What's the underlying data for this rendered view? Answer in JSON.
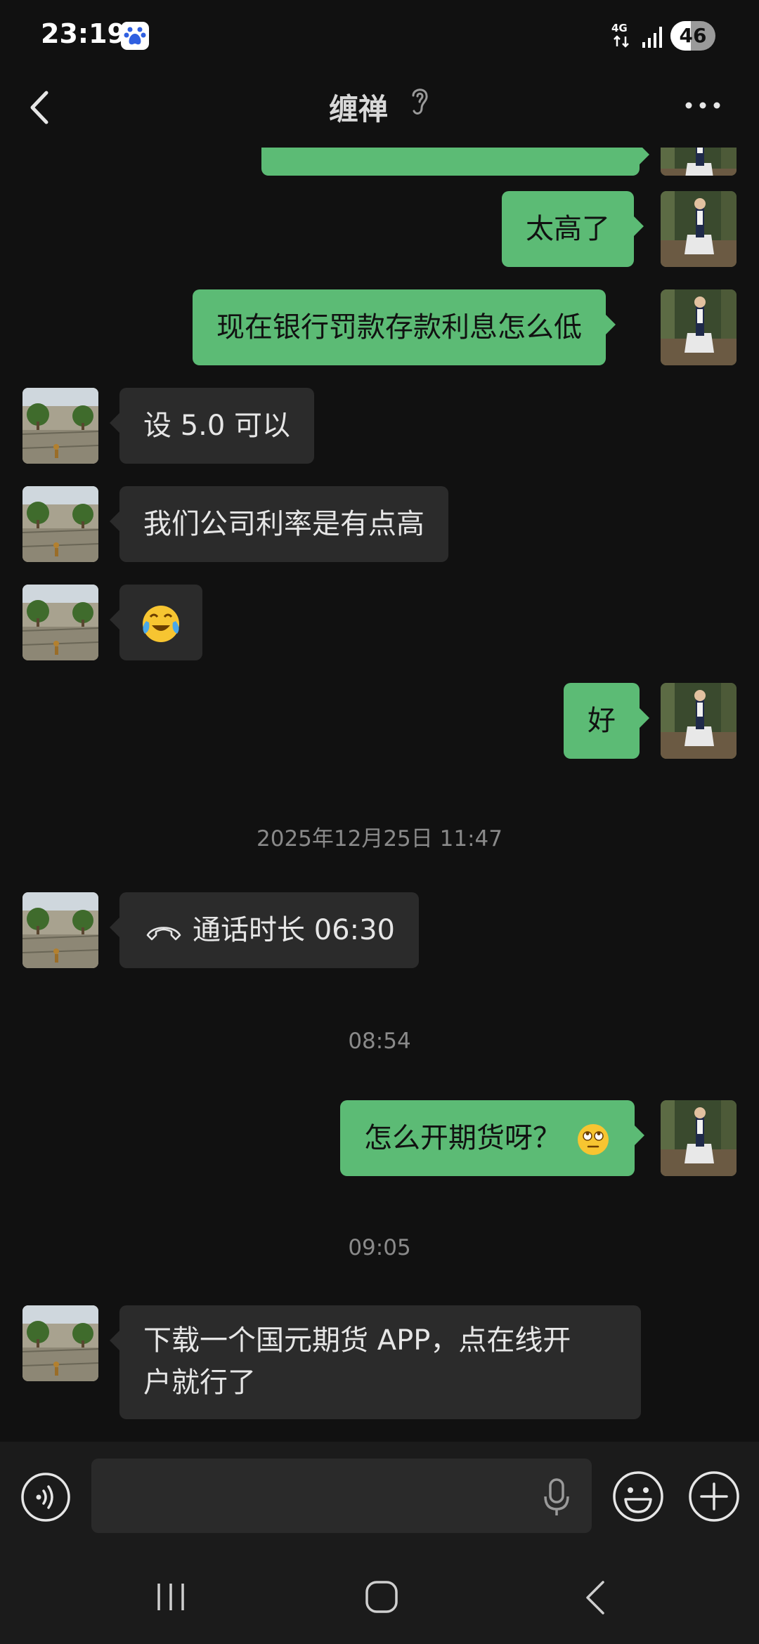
{
  "status_bar": {
    "time": "23:19",
    "network": "4G",
    "battery": "46",
    "battery_level": 0.46,
    "icons": [
      "baidu-app-icon",
      "4g-data-icon",
      "signal-icon",
      "battery-icon"
    ]
  },
  "header": {
    "title": "缠禅",
    "icons": [
      "back-chevron-icon",
      "earpiece-mode-icon",
      "more-dots-icon"
    ]
  },
  "messages": [
    {
      "from": "me",
      "type": "text",
      "text": "",
      "partial": true
    },
    {
      "from": "me",
      "type": "text",
      "text": "太高了"
    },
    {
      "from": "me",
      "type": "text",
      "text": "现在银行罚款存款利息怎么低"
    },
    {
      "from": "other",
      "type": "text",
      "text": "设 5.0 可以"
    },
    {
      "from": "other",
      "type": "text",
      "text": "我们公司利率是有点高"
    },
    {
      "from": "other",
      "type": "emoji",
      "text": "😭"
    },
    {
      "from": "me",
      "type": "text",
      "text": "好"
    },
    {
      "type": "timestamp",
      "text": "2025年12月25日 11:47"
    },
    {
      "from": "other",
      "type": "call",
      "text": "通话时长 06:30",
      "icon": "phone-hangup-icon"
    },
    {
      "type": "timestamp",
      "text": "08:54"
    },
    {
      "from": "me",
      "type": "text",
      "text": "怎么开期货呀？",
      "emoji": "🙄"
    },
    {
      "type": "timestamp",
      "text": "09:05"
    },
    {
      "from": "other",
      "type": "text",
      "lines": [
        "下载一个国元期货 APP，点在线开",
        "户就行了"
      ]
    }
  ],
  "input_bar": {
    "value": "",
    "icons": [
      "voice-input-icon",
      "mic-icon",
      "emoji-icon",
      "plus-icon"
    ]
  },
  "nav_bar": {
    "icons": [
      "recent-apps-icon",
      "home-icon",
      "nav-back-icon"
    ]
  },
  "colors": {
    "background": "#111111",
    "bubble_me": "#5cbb75",
    "bubble_other": "#2b2b2b",
    "timestamp": "#8a8a8a"
  }
}
